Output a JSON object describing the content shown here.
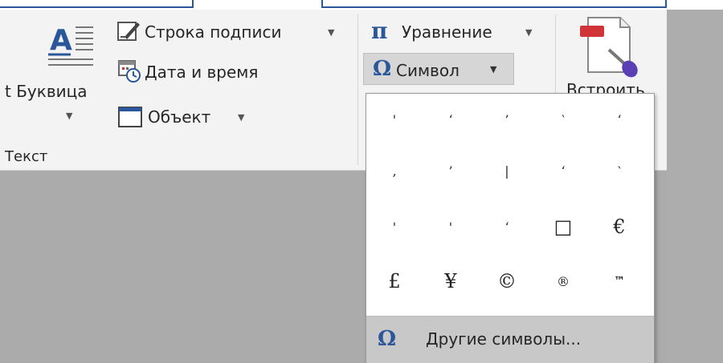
{
  "ribbon": {
    "insert_text_group": {
      "dropcap_label": "t Буквица",
      "signature_line_label": "Строка подписи",
      "date_time_label": "Дата и время",
      "object_label": "Объект",
      "group_label": "Текст"
    },
    "symbols_group": {
      "equation_label": "Уравнение",
      "symbol_label": "Символ",
      "embed_label": "Встроить"
    }
  },
  "symbol_menu": {
    "rows": [
      [
        "'",
        "‘",
        "’",
        "‵",
        "‘"
      ],
      [
        "‚",
        "’",
        "|",
        "‘",
        "‵"
      ],
      [
        "'",
        "'",
        "ʻ",
        "□",
        "€"
      ],
      [
        "£",
        "¥",
        "©",
        "®",
        "™"
      ]
    ],
    "more_symbols_label": "Другие символы..."
  },
  "colors": {
    "accent": "#2b579a",
    "ribbon_bg": "#f3f3f3",
    "menu_hover": "#c8c8c8"
  }
}
